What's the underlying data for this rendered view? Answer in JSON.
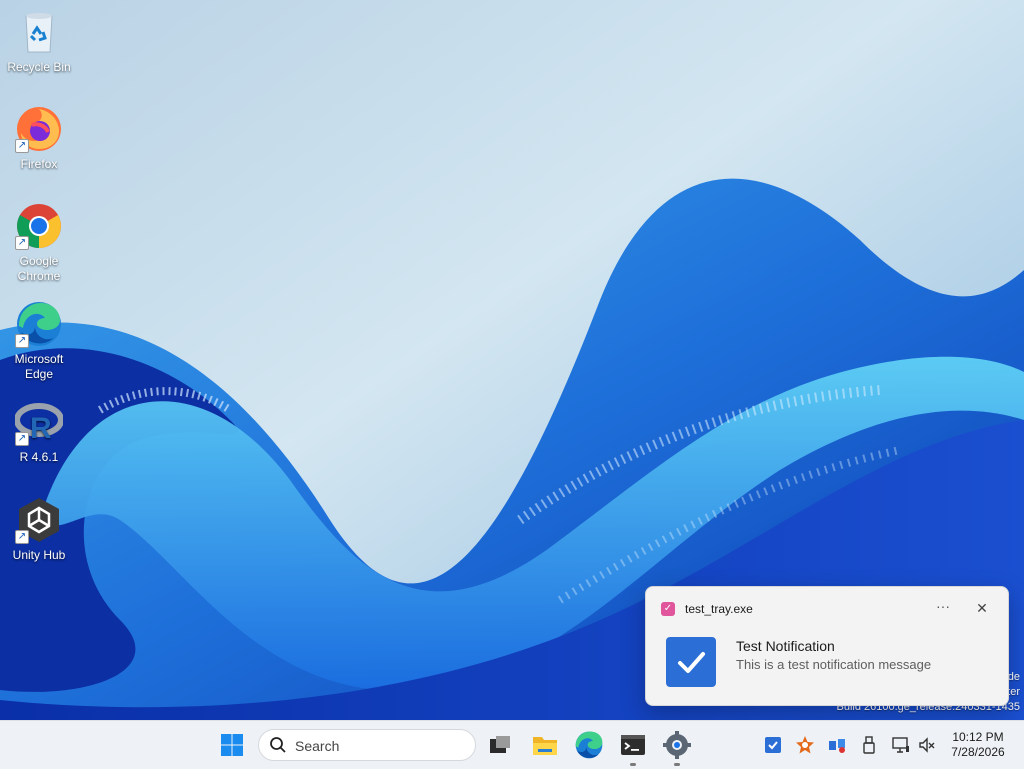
{
  "desktop": {
    "icons": [
      {
        "label": "Recycle Bin",
        "icon": "recycle-bin-icon"
      },
      {
        "label": "Firefox",
        "icon": "firefox-icon"
      },
      {
        "label": "Google Chrome",
        "icon": "chrome-icon"
      },
      {
        "label": "Microsoft Edge",
        "icon": "edge-icon"
      },
      {
        "label": "R 4.6.1",
        "icon": "r-icon"
      },
      {
        "label": "Unity Hub",
        "icon": "unity-hub-icon"
      }
    ],
    "watermark": {
      "line1": "de",
      "line2": "ter",
      "line3": "Build 26100.ge_release.240331-1435"
    }
  },
  "notification": {
    "app_name": "test_tray.exe",
    "title": "Test Notification",
    "message": "This is a test notification message",
    "more_label": "···",
    "close_label": "✕"
  },
  "taskbar": {
    "search_placeholder": "Search",
    "apps": [
      "start-icon",
      "task-view-icon",
      "file-explorer-icon",
      "edge-icon",
      "terminal-icon",
      "settings-icon"
    ],
    "tray_icons": [
      "todo-tray-icon",
      "flower-tray-icon",
      "network-share-tray-icon",
      "usb-tray-icon",
      "monitor-tray-icon",
      "volume-muted-icon"
    ],
    "clock": {
      "time": "10:12 PM",
      "date": "7/28/2026"
    }
  },
  "colors": {
    "accent": "#2b6fd6",
    "notification_app_icon": "#e0559b",
    "taskbar_bg": "#eef1f5"
  }
}
